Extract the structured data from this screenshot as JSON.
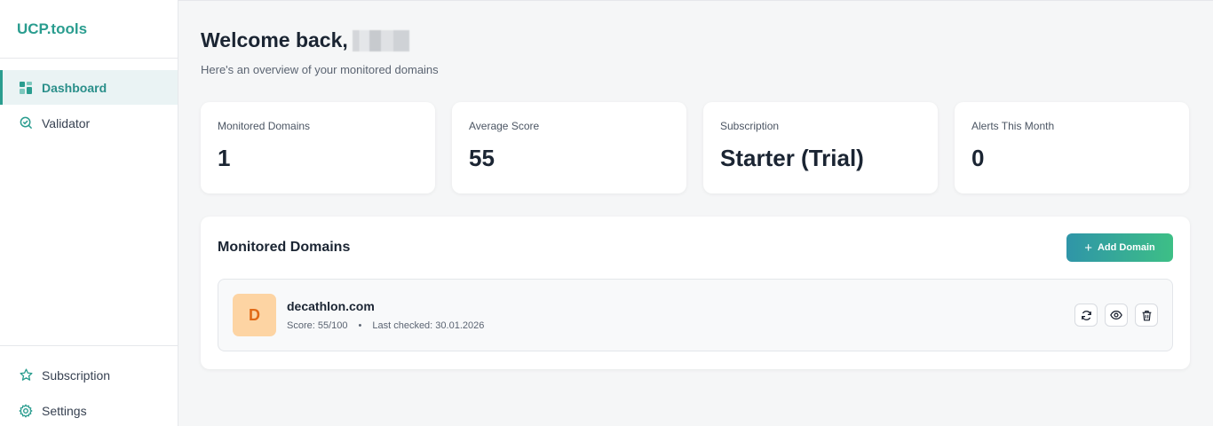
{
  "brand": "UCP.tools",
  "sidebar": {
    "items": [
      {
        "label": "Dashboard",
        "icon": "dashboard-icon",
        "active": true
      },
      {
        "label": "Validator",
        "icon": "search-check-icon",
        "active": false
      }
    ],
    "bottom_items": [
      {
        "label": "Subscription",
        "icon": "star-icon"
      },
      {
        "label": "Settings",
        "icon": "gear-icon"
      }
    ]
  },
  "header": {
    "welcome": "Welcome back,",
    "subtitle": "Here's an overview of your monitored domains"
  },
  "stats": [
    {
      "label": "Monitored Domains",
      "value": "1"
    },
    {
      "label": "Average Score",
      "value": "55"
    },
    {
      "label": "Subscription",
      "value": "Starter (Trial)"
    },
    {
      "label": "Alerts This Month",
      "value": "0"
    }
  ],
  "domains_panel": {
    "title": "Monitored Domains",
    "add_label": "Add Domain",
    "rows": [
      {
        "initial": "D",
        "name": "decathlon.com",
        "score": "Score: 55/100",
        "dot": "•",
        "last_checked": "Last checked: 30.01.2026"
      }
    ]
  },
  "colors": {
    "accent": "#2a9d8f",
    "avatar_bg": "#fdd4a3",
    "avatar_fg": "#e16a17"
  }
}
